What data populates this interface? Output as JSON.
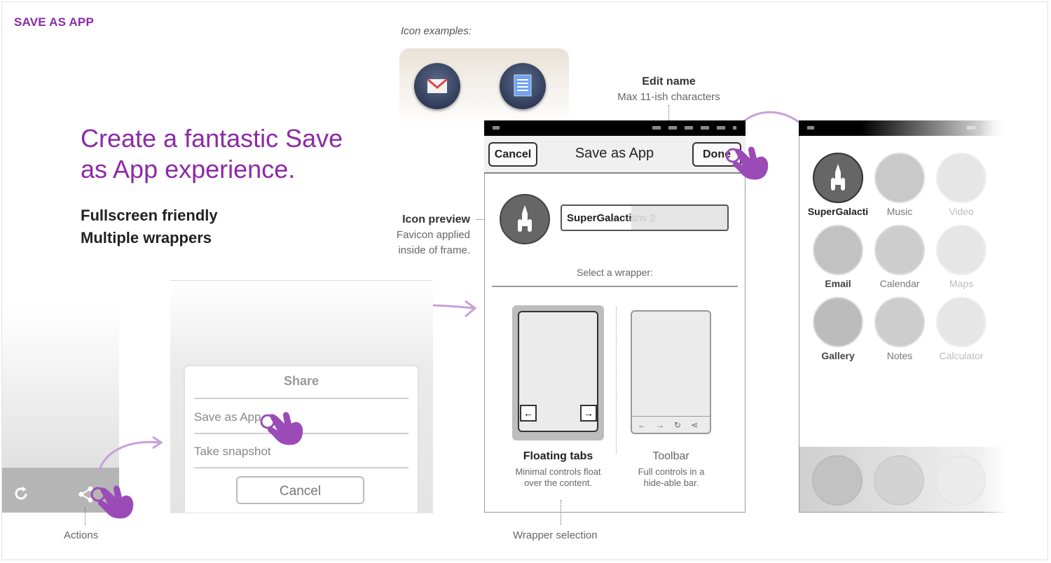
{
  "header": {
    "title": "SAVE AS APP"
  },
  "headline": "Create a fantastic Save as App experience.",
  "subpoints": [
    "Fullscreen friendly",
    "Multiple wrappers"
  ],
  "icon_examples_label": "Icon examples:",
  "annotations": {
    "edit_name_title": "Edit name",
    "edit_name_sub": "Max 11-ish characters",
    "icon_preview_title": "Icon preview",
    "icon_preview_sub1": "Favicon applied",
    "icon_preview_sub2": "inside of frame.",
    "actions": "Actions",
    "wrapper_selection": "Wrapper selection"
  },
  "share_sheet": {
    "title": "Share",
    "items": [
      "Save as App",
      "Take snapshot"
    ],
    "cancel": "Cancel"
  },
  "save_dialog": {
    "cancel": "Cancel",
    "title": "Save as App",
    "done": "Done",
    "name_value": "SuperGalacti",
    "name_overflow": "ans 2",
    "select_wrapper_label": "Select a wrapper:",
    "wrappers": [
      {
        "name": "Floating tabs",
        "desc": "Minimal controls float over the content."
      },
      {
        "name": "Toolbar",
        "desc": "Full controls in a hide-able bar."
      }
    ]
  },
  "home_screen": {
    "apps": [
      "SuperGalacti",
      "Music",
      "Video",
      "Email",
      "Calendar",
      "Maps",
      "Gallery",
      "Notes",
      "Calculator"
    ]
  },
  "colors": {
    "accent": "#8c2aa6",
    "hand": "#9b4bb8"
  }
}
